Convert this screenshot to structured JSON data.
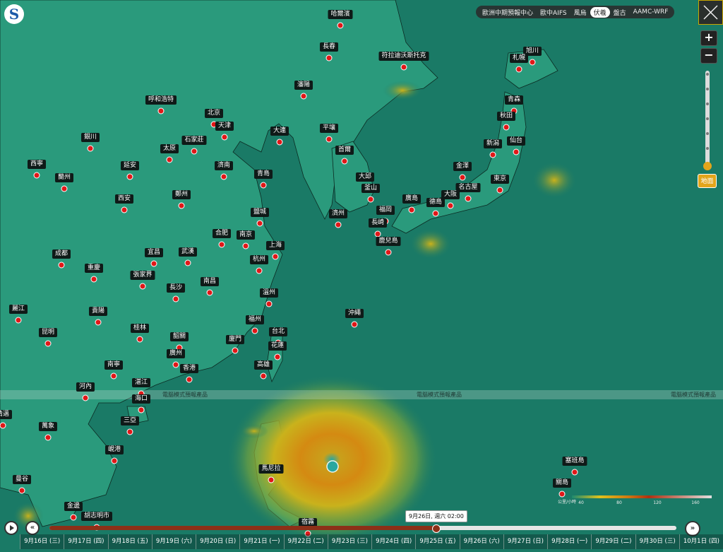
{
  "colors": {
    "ocean": "#1a7a66",
    "land": "#2a9a7c",
    "typhoon_core": "#d9a017",
    "marker": "#e01818",
    "timeline_progress": "#8c3018",
    "accent": "#e3a51b"
  },
  "logo": {
    "glyph": "S"
  },
  "model_selector": [
    {
      "label": "歐洲中期預報中心",
      "active": false
    },
    {
      "label": "歐中AIFS",
      "active": false
    },
    {
      "label": "風烏",
      "active": false
    },
    {
      "label": "伏羲",
      "active": true
    },
    {
      "label": "盤古",
      "active": false
    },
    {
      "label": "AAMC-WRF",
      "active": false
    }
  ],
  "controls": {
    "close_icon": "close-icon",
    "zoom_in": "+",
    "zoom_out": "−",
    "level_label": "地面",
    "level_steps": 7,
    "level_selected_index": 6
  },
  "banner": {
    "text": "電腦模式預報產品"
  },
  "legend": {
    "unit": "公里/小時",
    "ticks": [
      "40",
      "80",
      "120",
      "160"
    ]
  },
  "timeline": {
    "current_time": "9月26日, 週六 02:00",
    "progress": 0.617,
    "days": [
      "9月16日 (三)",
      "9月17日 (四)",
      "9月18日 (五)",
      "9月19日 (六)",
      "9月20日 (日)",
      "9月21日 (一)",
      "9月22日 (二)",
      "9月23日 (三)",
      "9月24日 (四)",
      "9月25日 (五)",
      "9月26日 (六)",
      "9月27日 (日)",
      "9月28日 (一)",
      "9月29日 (二)",
      "9月30日 (三)",
      "10月1日 (四)"
    ],
    "play_icon": "play-icon",
    "rewind_icon": "rewind-icon",
    "forward_icon": "fast-forward-icon"
  },
  "cities": [
    {
      "name": "哈爾濱"
    },
    {
      "name": "長春"
    },
    {
      "name": "符拉迪沃斯托克"
    },
    {
      "name": "旭川"
    },
    {
      "name": "札幌"
    },
    {
      "name": "瀋陽"
    },
    {
      "name": "呼和浩特"
    },
    {
      "name": "北京"
    },
    {
      "name": "天津"
    },
    {
      "name": "青森"
    },
    {
      "name": "大連"
    },
    {
      "name": "平壤"
    },
    {
      "name": "秋田"
    },
    {
      "name": "銀川"
    },
    {
      "name": "石家莊"
    },
    {
      "name": "太原"
    },
    {
      "name": "新潟"
    },
    {
      "name": "仙台"
    },
    {
      "name": "首爾"
    },
    {
      "name": "西寧"
    },
    {
      "name": "延安"
    },
    {
      "name": "濟南"
    },
    {
      "name": "金澤"
    },
    {
      "name": "蘭州"
    },
    {
      "name": "青島"
    },
    {
      "name": "大邱"
    },
    {
      "name": "東京"
    },
    {
      "name": "名古屋"
    },
    {
      "name": "釜山"
    },
    {
      "name": "鄭州"
    },
    {
      "name": "西安"
    },
    {
      "name": "大阪"
    },
    {
      "name": "廣島"
    },
    {
      "name": "德島"
    },
    {
      "name": "福岡"
    },
    {
      "name": "濟州"
    },
    {
      "name": "鹽城"
    },
    {
      "name": "長崎"
    },
    {
      "name": "合肥"
    },
    {
      "name": "南京"
    },
    {
      "name": "鹿兒島"
    },
    {
      "name": "上海"
    },
    {
      "name": "成都"
    },
    {
      "name": "宜昌"
    },
    {
      "name": "武漢"
    },
    {
      "name": "杭州"
    },
    {
      "name": "重慶"
    },
    {
      "name": "張家界"
    },
    {
      "name": "南昌"
    },
    {
      "name": "長沙"
    },
    {
      "name": "溫州"
    },
    {
      "name": "麗江"
    },
    {
      "name": "貴陽"
    },
    {
      "name": "沖繩"
    },
    {
      "name": "福州"
    },
    {
      "name": "昆明"
    },
    {
      "name": "桂林"
    },
    {
      "name": "台北"
    },
    {
      "name": "韶關"
    },
    {
      "name": "廈門"
    },
    {
      "name": "花蓮"
    },
    {
      "name": "廣州"
    },
    {
      "name": "南寧"
    },
    {
      "name": "香港"
    },
    {
      "name": "高雄"
    },
    {
      "name": "河內"
    },
    {
      "name": "湛江"
    },
    {
      "name": "海口"
    },
    {
      "name": "清邁"
    },
    {
      "name": "三亞"
    },
    {
      "name": "萬象"
    },
    {
      "name": "峴港"
    },
    {
      "name": "馬尼拉"
    },
    {
      "name": "塞班島"
    },
    {
      "name": "曼谷"
    },
    {
      "name": "關島"
    },
    {
      "name": "金邊"
    },
    {
      "name": "胡志明市"
    },
    {
      "name": "宿霧"
    }
  ]
}
